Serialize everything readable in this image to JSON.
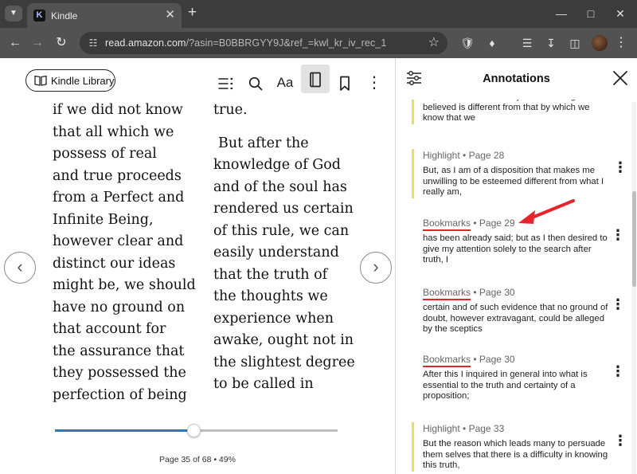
{
  "browser": {
    "tab_title": "Kindle",
    "url_host": "read.amazon.com",
    "url_path": "/?asin=B0BBRGYY9J&ref_=kwl_kr_iv_rec_1"
  },
  "reader": {
    "library_button": "Kindle Library",
    "left_column": [
      "if we did not know",
      "that all which we",
      "possess of real",
      "and true proceeds",
      "from a Perfect and",
      "Infinite Being,",
      "however clear and",
      "distinct our ideas",
      "might be, we should",
      "have no ground on",
      "that account for",
      "the assurance that",
      "they possessed the",
      "perfection of being"
    ],
    "right_column_top": "true.",
    "right_column": [
      "But after the",
      "knowledge of God",
      "and of the soul has",
      "rendered us certain",
      "of this rule, we can",
      "easily understand",
      "that the truth of",
      "the thoughts we",
      "experience when",
      "awake, ought not in",
      "the slightest degree",
      "to be called in"
    ],
    "progress_percent": 49,
    "page_status": "Page 35 of 68  •  49%"
  },
  "annotations": {
    "title": "Annotations",
    "items": [
      {
        "kind": "",
        "page": "",
        "text": "for, as the act of mind by which a thing is believed is different from that by which we know that we"
      },
      {
        "kind": "Highlight",
        "page": " • Page 28",
        "text": "But, as I am of a disposition that makes me unwilling to be esteemed different from what I really am,"
      },
      {
        "kind": "Bookmarks",
        "page": " • Page 29",
        "text": "has been already said; but as I then desired to give my attention solely to the search after truth, I"
      },
      {
        "kind": "Bookmarks",
        "page": " • Page 30",
        "text": "certain and of such evidence that no ground of doubt, however extravagant, could be alleged by the sceptics"
      },
      {
        "kind": "Bookmarks",
        "page": " • Page 30",
        "text": "After this I inquired in general into what is essential to the truth and certainty of a proposition;"
      },
      {
        "kind": "Highlight",
        "page": " • Page 33",
        "text": "But the reason which leads many to persuade them selves that there is a difficulty in knowing this truth,"
      }
    ]
  },
  "colors": {
    "highlight_bar": "#f3dc55",
    "bookmark_underline": "#e0252b",
    "progress_fill": "#2a7bbf",
    "annotation_arrow": "#e8232a"
  }
}
